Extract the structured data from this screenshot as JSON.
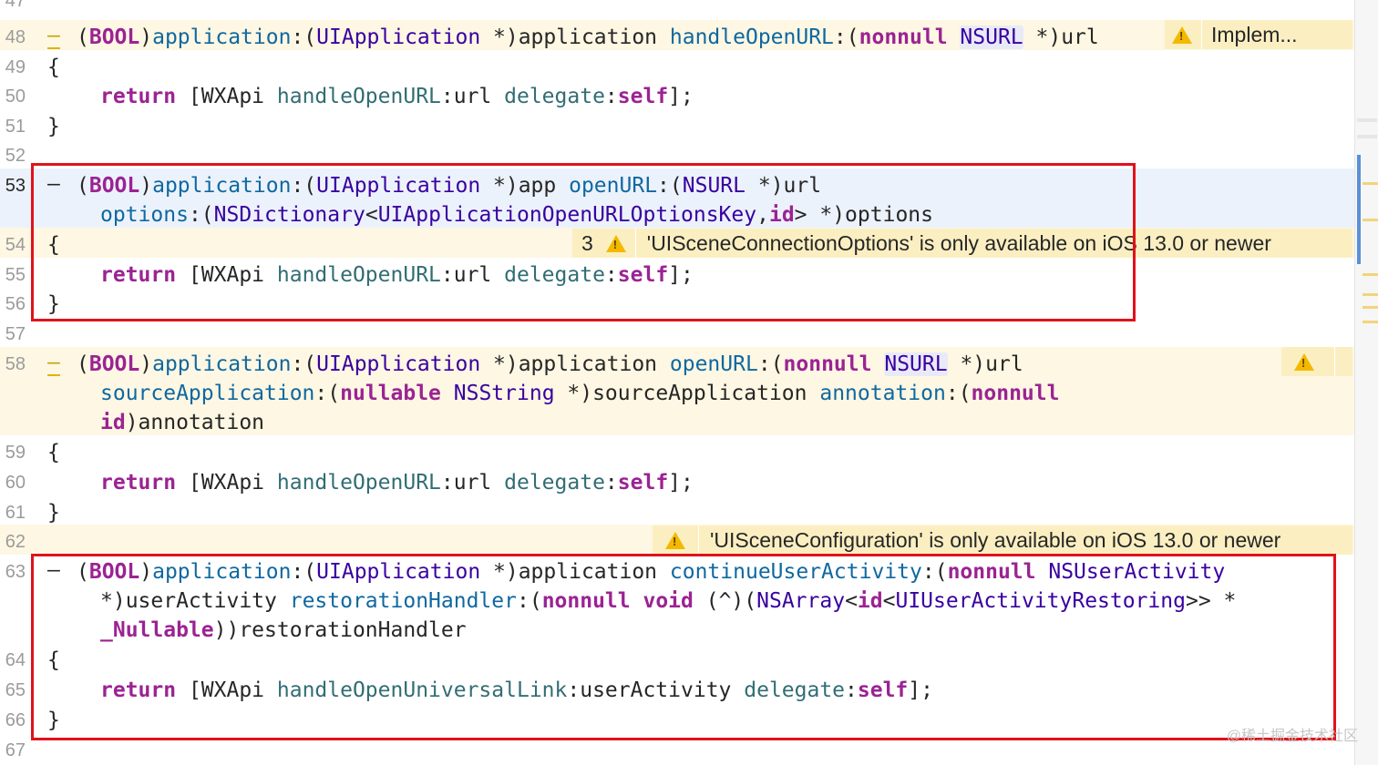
{
  "lines": {
    "l47": "47",
    "l48": "48",
    "l49": "49",
    "l50": "50",
    "l51": "51",
    "l52": "52",
    "l53": "53",
    "l54": "54",
    "l55": "55",
    "l56": "56",
    "l57": "57",
    "l58": "58",
    "l59": "59",
    "l60": "60",
    "l61": "61",
    "l62": "62",
    "l63": "63",
    "l64": "64",
    "l65": "65",
    "l66": "66",
    "l67": "67"
  },
  "code": {
    "dash": "–",
    "bool_open": "(",
    "bool": "BOOL",
    "bool_close": ")",
    "application": "application",
    "colon": ":",
    "uiapplication": "UIApplication",
    "star_application": " *)application ",
    "star_app": " *)app ",
    "handleOpenURL": "handleOpenURL",
    "openURL": "openURL",
    "nonnull": "nonnull",
    "nsurl": "NSURL",
    "star_url": " *)url",
    "options_sel": "options",
    "nsdictionary": "NSDictionary",
    "options_key": "UIApplicationOpenURLOptionsKey",
    "comma": ",",
    "id": "id",
    "star_options": "> *)options",
    "sourceApplication": "sourceApplication",
    "nullable": "nullable",
    "nsstring": "NSString",
    "star_source": " *)sourceApplication ",
    "annotation": "annotation",
    "id_annotation": ")annotation",
    "continueUserActivity": "continueUserActivity",
    "nsuseractivity": "NSUserActivity",
    "star_useractivity": "*)userActivity ",
    "restorationHandler": "restorationHandler",
    "void": "void",
    "block": " (^)(",
    "nsarray": "NSArray",
    "uiuseractivityrestoring": "UIUserActivityRestoring",
    "generic_close": ">> *",
    "nullable_kw": "_Nullable",
    "restoration_param": "))restorationHandler",
    "open_brace": "{",
    "close_brace": "}",
    "return": "return",
    "wxapi_open": " [WXApi ",
    "handleOpenUniversalLink": "handleOpenUniversalLink",
    "url_arg": ":url ",
    "useractivity_arg": ":userActivity ",
    "delegate": "delegate",
    "self": "self",
    "end": "];",
    "lt": "<",
    "paren_open": "(",
    "paren_close": ")"
  },
  "issues": {
    "implem": "Implem...",
    "scene_count": "3",
    "scene_connection": "'UISceneConnectionOptions' is only available on iOS 13.0 or newer",
    "scene_configuration": "'UISceneConfiguration' is only available on iOS 13.0 or newer"
  },
  "colors": {
    "keyword": "#9b2393",
    "type": "#3900a0",
    "selector": "#326d74",
    "highlight_box": "#e0121b",
    "warning": "#f5b800"
  },
  "watermark": "@稀土掘金技术社区"
}
